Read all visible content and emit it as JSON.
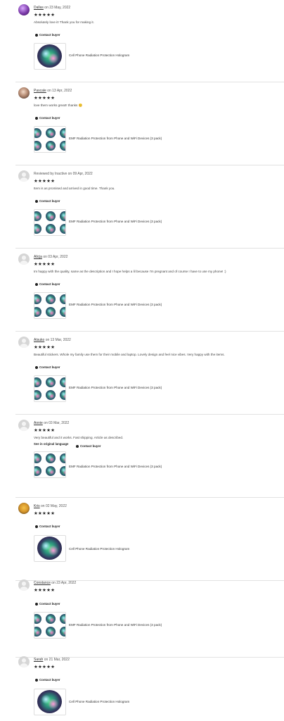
{
  "reviews": [
    {
      "name": "Dallas",
      "date_text": "on 23 May, 2022",
      "stars": "★★★★★",
      "text": "Absolutely love it! Thank you for making it.",
      "contact": "Contact buyer",
      "product": "Cell Phone Radiation Protection Hologram",
      "avatar": "purple-avatar"
    },
    {
      "name": "Pascale",
      "date_text": "on 13 Apr, 2022",
      "stars": "★★★★★",
      "text": "love them works great!! thanks 😊",
      "contact": "Contact buyer",
      "product": "EMF Radiation Protection from Phone and WiFi Devices (3 pack)",
      "avatar": "photo-avatar"
    },
    {
      "name": "",
      "date_text": "Reviewed by Inactive on 09 Apr, 2022",
      "stars": "★★★★★",
      "text": "Item is as promised and arrived in good time. Thank you.",
      "contact": "Contact buyer",
      "product": "EMF Radiation Protection from Phone and WiFi Devices (3 pack)",
      "avatar": "default-avatar"
    },
    {
      "name": "Alicja",
      "date_text": "on 03 Apr, 2022",
      "stars": "★★★★★",
      "text": "Im happy with the quality, same as the description and I hope helps a lil because I'm pregnant and of course I have to use my phone! :)",
      "contact": "Contact buyer",
      "product": "EMF Radiation Protection from Phone and WiFi Devices (3 pack)",
      "avatar": "default-avatar"
    },
    {
      "name": "Atsuko",
      "date_text": "on 13 Mar, 2022",
      "stars": "★★★★★",
      "text": "Beautiful stickers. Whole my family use them for their mobile and laptop. Lovely design and feel nice vibes. Very happy with the items.",
      "contact": "Contact buyer",
      "product": "EMF Radiation Protection from Phone and WiFi Devices (3 pack)",
      "avatar": "default-avatar"
    },
    {
      "name": "Annie",
      "date_text": "on 03 Mar, 2022",
      "stars": "★★★★★",
      "text": "Very beautiful and it works. Fast shipping. Article as described.",
      "original_language": "See in original language",
      "contact": "Contact buyer",
      "product": "EMF Radiation Protection from Phone and WiFi Devices (3 pack)",
      "avatar": "default-avatar"
    },
    {
      "name": "Kris",
      "date_text": "on 02 May, 2022",
      "stars": "★★★★★",
      "text": "",
      "contact": "Contact buyer",
      "product": "Cell Phone Radiation Protection Hologram",
      "avatar": "photo-avatar"
    },
    {
      "name": "Constance",
      "date_text": "on 23 Apr, 2022",
      "stars": "★★★★★",
      "text": "",
      "contact": "Contact buyer",
      "product": "EMF Radiation Protection from Phone and WiFi Devices (3 pack)",
      "avatar": "default-avatar"
    },
    {
      "name": "Sarah",
      "date_text": "on 21 Mar, 2022",
      "stars": "★★★★★",
      "text": "",
      "contact": "Contact buyer",
      "product": "Cell Phone Radiation Protection Hologram",
      "avatar": "default-avatar"
    }
  ]
}
